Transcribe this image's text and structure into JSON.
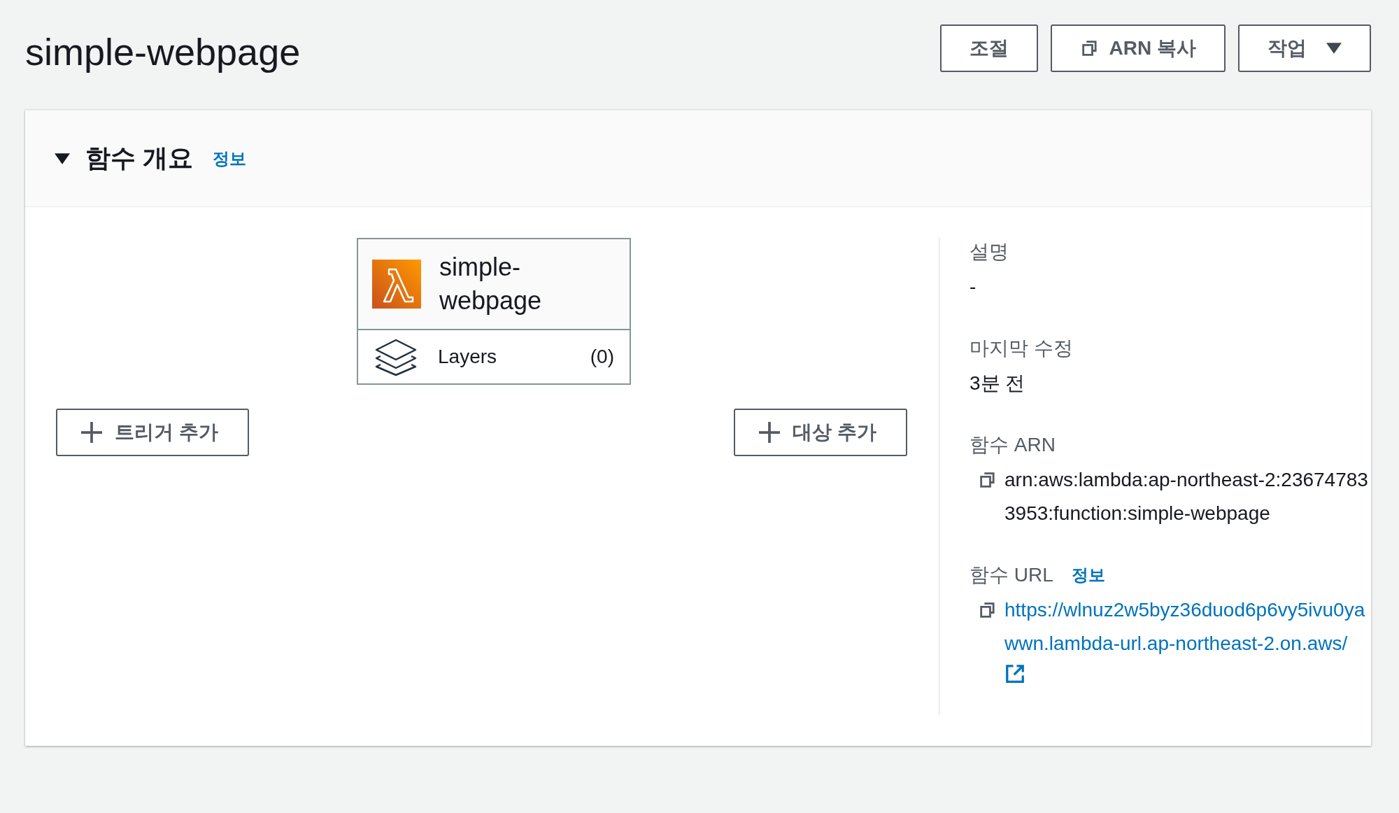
{
  "page_title": "simple-webpage",
  "header_buttons": [
    {
      "label": "조절",
      "kind": "plain"
    },
    {
      "label": "ARN 복사",
      "kind": "copy"
    },
    {
      "label": "작업",
      "kind": "dropdown"
    }
  ],
  "overview": {
    "title": "함수 개요",
    "info_link": "정보",
    "expanded": true,
    "function": {
      "name": "simple-webpage",
      "layers_label": "Layers",
      "layers_count": "(0)"
    },
    "add_trigger": "트리거 추가",
    "add_destination": "대상 추가",
    "details": [
      {
        "label": "설명",
        "value": "-",
        "kind": "text"
      },
      {
        "label": "마지막 수정",
        "value": "3분 전",
        "kind": "text"
      },
      {
        "label": "함수 ARN",
        "value": "arn:aws:lambda:ap-northeast-2:236747833953:function:simple-webpage",
        "kind": "copy"
      },
      {
        "label": "함수 URL",
        "info_link": "정보",
        "value": "https://wlnuz2w5byz36duod6p6vy5ivu0yawwn.lambda-url.ap-northeast-2.on.aws/",
        "kind": "link"
      }
    ]
  }
}
